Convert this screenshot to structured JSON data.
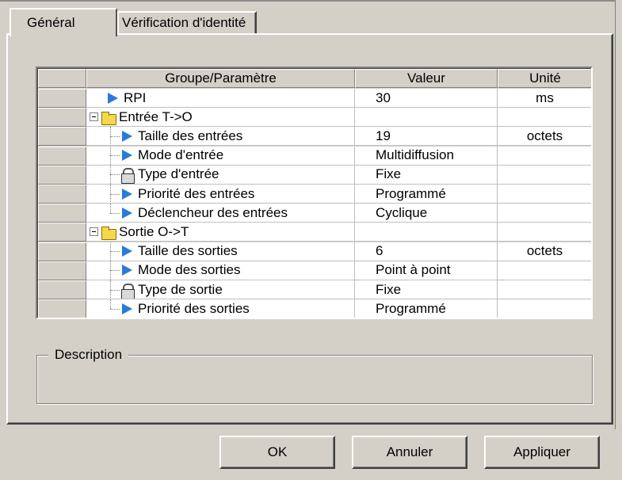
{
  "tabs": [
    {
      "label": "Général",
      "active": true
    },
    {
      "label": "Vérification d'identité",
      "active": false
    }
  ],
  "grid": {
    "columns": [
      "Groupe/Paramètre",
      "Valeur",
      "Unité"
    ],
    "rows": [
      {
        "name": "RPI",
        "value": "30",
        "unit": "ms",
        "icon": "arrow-icon",
        "level": 0
      },
      {
        "name": "Entrée T->O",
        "value": "",
        "unit": "",
        "icon": "folder-icon",
        "level": 0,
        "group": true
      },
      {
        "name": "Taille des entrées",
        "value": "19",
        "unit": "octets",
        "icon": "arrow-icon",
        "level": 1
      },
      {
        "name": "Mode d'entrée",
        "value": "Multidiffusion",
        "unit": "",
        "icon": "arrow-icon",
        "level": 1
      },
      {
        "name": "Type d'entrée",
        "value": "Fixe",
        "unit": "",
        "icon": "lock-icon",
        "level": 1
      },
      {
        "name": "Priorité des entrées",
        "value": "Programmé",
        "unit": "",
        "icon": "arrow-icon",
        "level": 1
      },
      {
        "name": "Déclencheur des entrées",
        "value": "Cyclique",
        "unit": "",
        "icon": "arrow-icon",
        "level": 1,
        "last": true
      },
      {
        "name": "Sortie O->T",
        "value": "",
        "unit": "",
        "icon": "folder-icon",
        "level": 0,
        "group": true
      },
      {
        "name": "Taille des sorties",
        "value": "6",
        "unit": "octets",
        "icon": "arrow-icon",
        "level": 1
      },
      {
        "name": "Mode des sorties",
        "value": "Point à point",
        "unit": "",
        "icon": "arrow-icon",
        "level": 1
      },
      {
        "name": "Type de sortie",
        "value": "Fixe",
        "unit": "",
        "icon": "lock-icon",
        "level": 1
      },
      {
        "name": "Priorité des sorties",
        "value": "Programmé",
        "unit": "",
        "icon": "arrow-icon",
        "level": 1,
        "last": true
      }
    ]
  },
  "description": {
    "label": "Description"
  },
  "buttons": {
    "ok": "OK",
    "cancel": "Annuler",
    "apply": "Appliquer"
  }
}
